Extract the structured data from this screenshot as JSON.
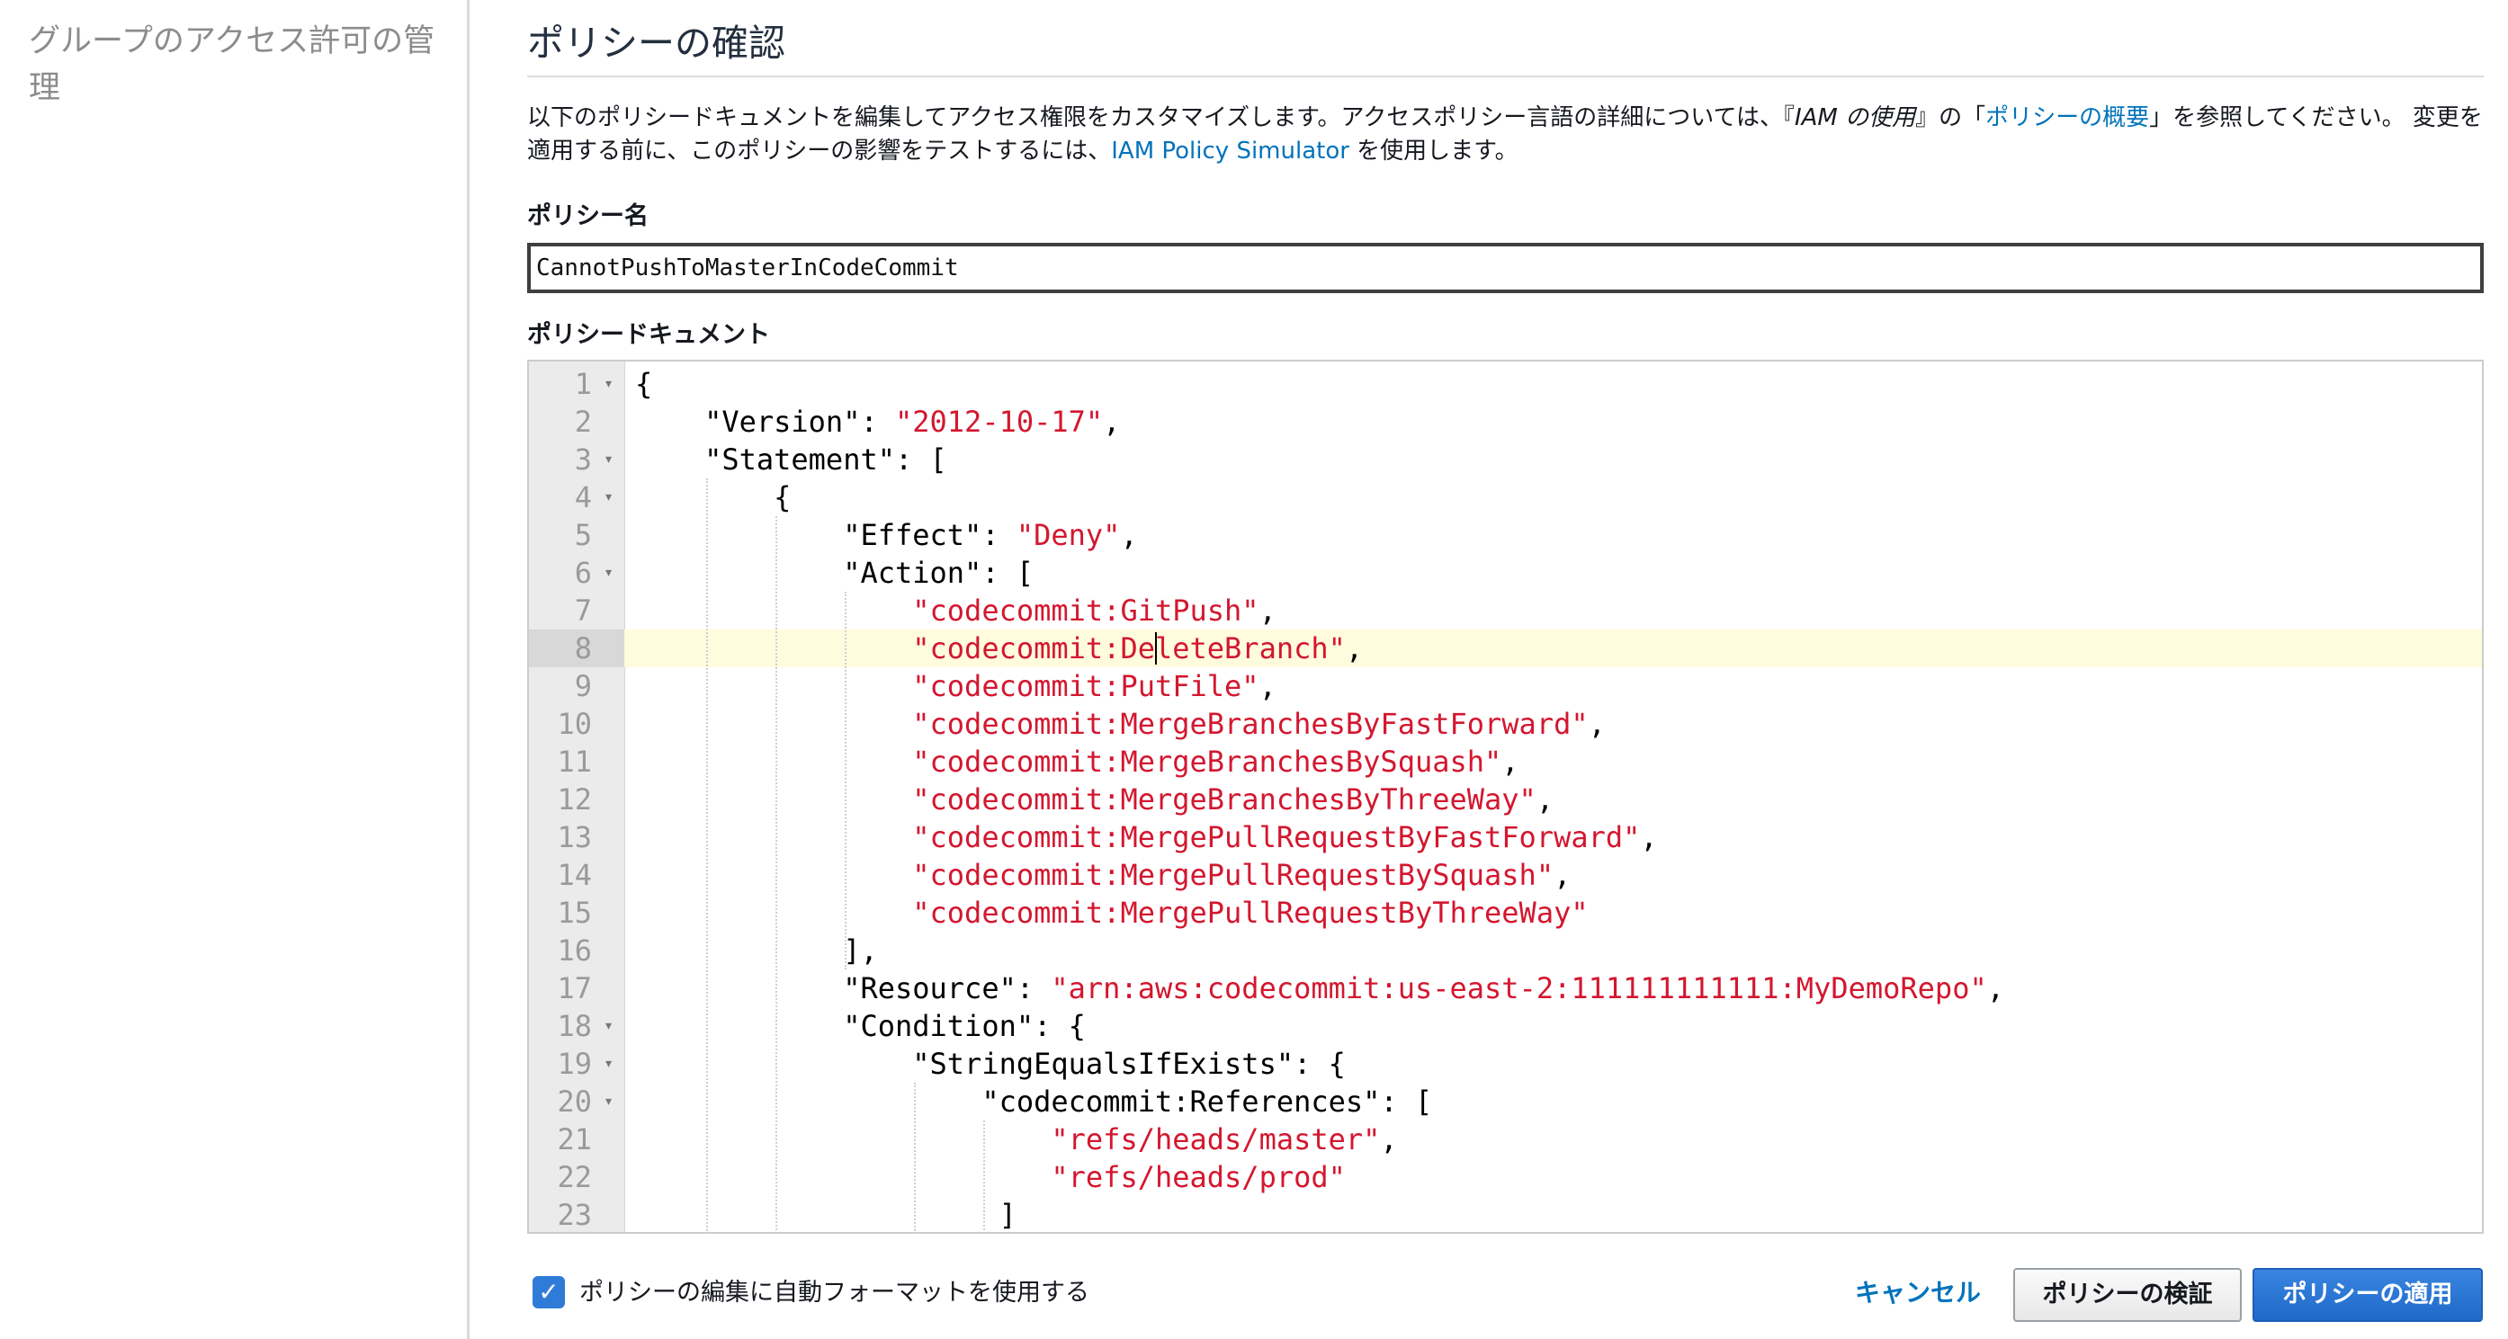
{
  "sidebar": {
    "title": "グループのアクセス許可の管理"
  },
  "main": {
    "heading": "ポリシーの確認",
    "description": {
      "part1": "以下のポリシードキュメントを編集してアクセス権限をカスタマイズします。アクセスポリシー言語の詳細については、『",
      "guide_title": "IAM の使用",
      "part2": "』の「",
      "overview_link": "ポリシーの概要",
      "part3": "」を参照してください。 変更を適用する前に、このポリシーの影響をテストするには、",
      "simulator_link": "IAM Policy Simulator",
      "part4": " を使用します。"
    },
    "policy_name_label": "ポリシー名",
    "policy_name_value": "CannotPushToMasterInCodeCommit",
    "policy_document_label": "ポリシードキュメント",
    "editor": {
      "lines": [
        {
          "num": "1",
          "fold": "▾",
          "text": "{"
        },
        {
          "num": "2",
          "fold": "",
          "text": "    \"Version\": \"2012-10-17\","
        },
        {
          "num": "3",
          "fold": "▾",
          "text": "    \"Statement\": ["
        },
        {
          "num": "4",
          "fold": "▾",
          "text": "        {"
        },
        {
          "num": "5",
          "fold": "",
          "text": "            \"Effect\": \"Deny\","
        },
        {
          "num": "6",
          "fold": "▾",
          "text": "            \"Action\": ["
        },
        {
          "num": "7",
          "fold": "",
          "text": "                \"codecommit:GitPush\","
        },
        {
          "num": "8",
          "fold": "",
          "text": "                \"codecommit:DeleteBranch\","
        },
        {
          "num": "9",
          "fold": "",
          "text": "                \"codecommit:PutFile\","
        },
        {
          "num": "10",
          "fold": "",
          "text": "                \"codecommit:MergeBranchesByFastForward\","
        },
        {
          "num": "11",
          "fold": "",
          "text": "                \"codecommit:MergeBranchesBySquash\","
        },
        {
          "num": "12",
          "fold": "",
          "text": "                \"codecommit:MergeBranchesByThreeWay\","
        },
        {
          "num": "13",
          "fold": "",
          "text": "                \"codecommit:MergePullRequestByFastForward\","
        },
        {
          "num": "14",
          "fold": "",
          "text": "                \"codecommit:MergePullRequestBySquash\","
        },
        {
          "num": "15",
          "fold": "",
          "text": "                \"codecommit:MergePullRequestByThreeWay\""
        },
        {
          "num": "16",
          "fold": "",
          "text": "            ],"
        },
        {
          "num": "17",
          "fold": "",
          "text": "            \"Resource\": \"arn:aws:codecommit:us-east-2:111111111111:MyDemoRepo\","
        },
        {
          "num": "18",
          "fold": "▾",
          "text": "            \"Condition\": {"
        },
        {
          "num": "19",
          "fold": "▾",
          "text": "                \"StringEqualsIfExists\": {"
        },
        {
          "num": "20",
          "fold": "▾",
          "text": "                    \"codecommit:References\": ["
        },
        {
          "num": "21",
          "fold": "",
          "text": "                        \"refs/heads/master\","
        },
        {
          "num": "22",
          "fold": "",
          "text": "                        \"refs/heads/prod\""
        },
        {
          "num": "23",
          "fold": "",
          "text": "                     ]"
        }
      ],
      "active_line": "8"
    }
  },
  "footer": {
    "autoformat_checked": true,
    "autoformat_label": "ポリシーの編集に自動フォーマットを使用する",
    "cancel_label": "キャンセル",
    "validate_label": "ポリシーの検証",
    "apply_label": "ポリシーの適用"
  },
  "colors": {
    "link": "#0073bb",
    "string": "#d3172f",
    "active_line": "#fffbdd",
    "primary_button": "#1f69c9"
  }
}
